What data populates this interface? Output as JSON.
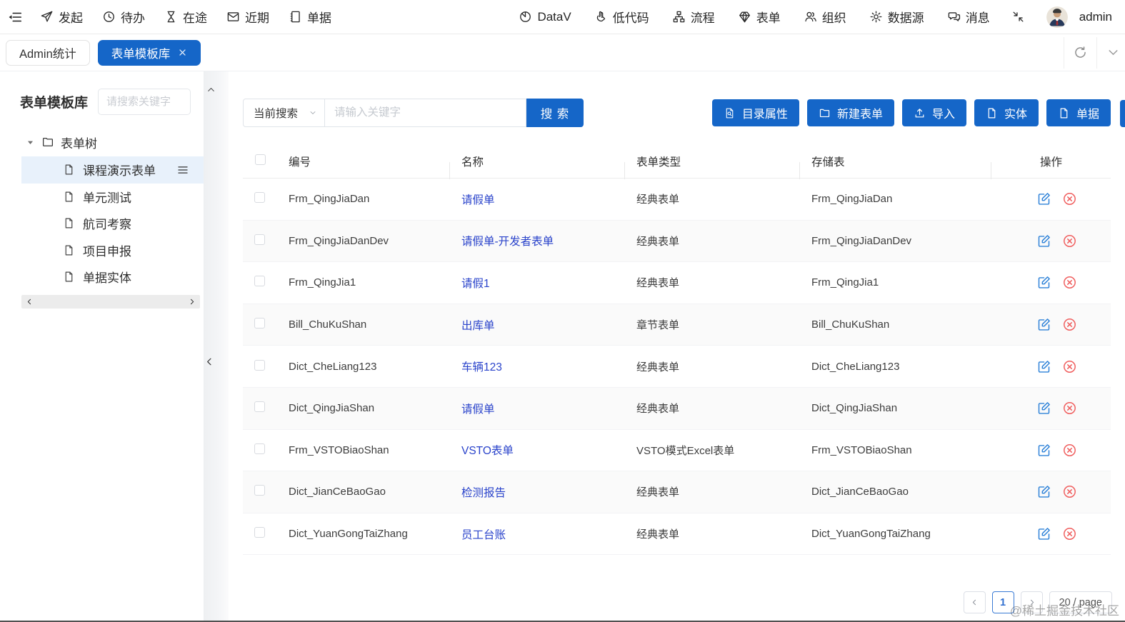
{
  "topnav": {
    "left": [
      {
        "id": "initiate",
        "icon": "send",
        "label": "发起"
      },
      {
        "id": "todo",
        "icon": "clock",
        "label": "待办"
      },
      {
        "id": "in-transit",
        "icon": "hourglass",
        "label": "在途"
      },
      {
        "id": "recent",
        "icon": "mail",
        "label": "近期"
      },
      {
        "id": "bills",
        "icon": "notebook",
        "label": "单据"
      }
    ],
    "right": [
      {
        "id": "datav",
        "icon": "pie-chart",
        "label": "DataV"
      },
      {
        "id": "lowcode",
        "icon": "hand",
        "label": "低代码"
      },
      {
        "id": "flow",
        "icon": "sitemap",
        "label": "流程"
      },
      {
        "id": "form",
        "icon": "gem",
        "label": "表单"
      },
      {
        "id": "org",
        "icon": "users",
        "label": "组织"
      },
      {
        "id": "datasource",
        "icon": "gear",
        "label": "数据源"
      },
      {
        "id": "message",
        "icon": "chat",
        "label": "消息"
      }
    ],
    "user": "admin"
  },
  "tabs": [
    {
      "id": "admin-stats",
      "label": "Admin统计",
      "active": false,
      "closable": false
    },
    {
      "id": "form-template-library",
      "label": "表单模板库",
      "active": true,
      "closable": true
    }
  ],
  "sidebar": {
    "title": "表单模板库",
    "search_placeholder": "请搜索关键字",
    "tree_root": "表单树",
    "items": [
      "课程演示表单",
      "单元测试",
      "航司考察",
      "项目申报",
      "单据实体"
    ],
    "selected": "课程演示表单"
  },
  "toolbar": {
    "search_field": "当前搜索",
    "input_placeholder": "请输入关键字",
    "search_button": "搜 索",
    "actions": [
      {
        "id": "catalog-props",
        "icon": "doc-search",
        "label": "目录属性"
      },
      {
        "id": "new-form",
        "icon": "folder",
        "label": "新建表单"
      },
      {
        "id": "import",
        "icon": "upload",
        "label": "导入"
      },
      {
        "id": "entity",
        "icon": "doc",
        "label": "实体"
      },
      {
        "id": "bill",
        "icon": "doc",
        "label": "单据"
      }
    ]
  },
  "table": {
    "columns": [
      "编号",
      "名称",
      "表单类型",
      "存储表",
      "操作"
    ],
    "rows": [
      {
        "code": "Frm_QingJiaDan",
        "name": "请假单",
        "type": "经典表单",
        "store": "Frm_QingJiaDan"
      },
      {
        "code": "Frm_QingJiaDanDev",
        "name": "请假单-开发者表单",
        "type": "经典表单",
        "store": "Frm_QingJiaDanDev"
      },
      {
        "code": "Frm_QingJia1",
        "name": "请假1",
        "type": "经典表单",
        "store": "Frm_QingJia1"
      },
      {
        "code": "Bill_ChuKuShan",
        "name": "出库单",
        "type": "章节表单",
        "store": "Bill_ChuKuShan"
      },
      {
        "code": "Dict_CheLiang123",
        "name": "车辆123",
        "type": "经典表单",
        "store": "Dict_CheLiang123"
      },
      {
        "code": "Dict_QingJiaShan",
        "name": "请假单",
        "type": "经典表单",
        "store": "Dict_QingJiaShan"
      },
      {
        "code": "Frm_VSTOBiaoShan",
        "name": "VSTO表单",
        "type": "VSTO模式Excel表单",
        "store": "Frm_VSTOBiaoShan"
      },
      {
        "code": "Dict_JianCeBaoGao",
        "name": "检测报告",
        "type": "经典表单",
        "store": "Dict_JianCeBaoGao"
      },
      {
        "code": "Dict_YuanGongTaiZhang",
        "name": "员工台账",
        "type": "经典表单",
        "store": "Dict_YuanGongTaiZhang"
      }
    ]
  },
  "pagination": {
    "current": "1",
    "page_size": "20 / page"
  },
  "watermark": "@稀土掘金技术社区",
  "colors": {
    "primary": "#1566c8",
    "link": "#2b44cb",
    "danger": "#f05e5e",
    "edit": "#2e82d8",
    "tree_sel": "#e8f1fb"
  }
}
